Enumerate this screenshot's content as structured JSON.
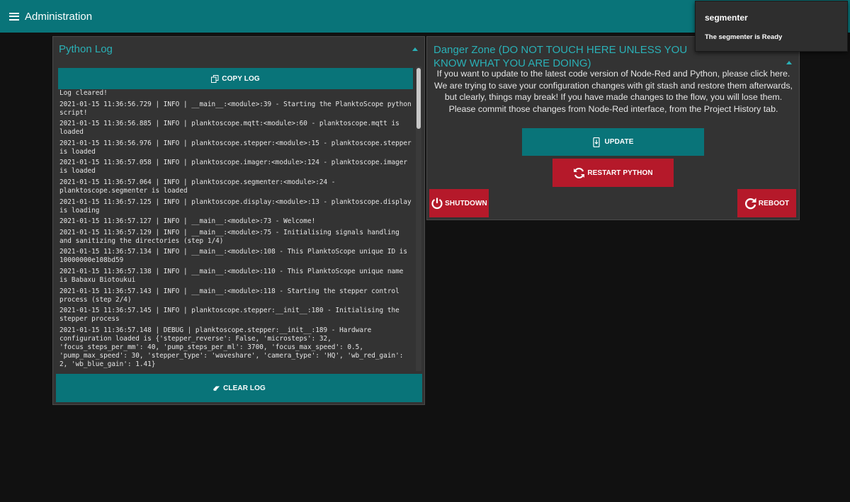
{
  "header": {
    "title": "Administration",
    "menu_icon": "hamburger-menu-icon",
    "color": "#097479"
  },
  "log_panel": {
    "title": "Python Log",
    "copy_button_label": "COPY LOG",
    "copy_icon": "copy-icon",
    "clear_button_label": "CLEAR LOG",
    "clear_icon": "eraser-icon",
    "lines": [
      "Log cleared!",
      "2021-01-15 11:36:56.729 | INFO | __main__:<module>:39 - Starting the PlanktoScope python script!",
      "2021-01-15 11:36:56.885 | INFO | planktoscope.mqtt:<module>:60 - planktoscope.mqtt is loaded",
      "2021-01-15 11:36:56.976 | INFO | planktoscope.stepper:<module>:15 - planktoscope.stepper is loaded",
      "2021-01-15 11:36:57.058 | INFO | planktoscope.imager:<module>:124 - planktoscope.imager is loaded",
      "2021-01-15 11:36:57.064 | INFO | planktoscope.segmenter:<module>:24 - planktoscope.segmenter is loaded",
      "2021-01-15 11:36:57.125 | INFO | planktoscope.display:<module>:13 - planktoscope.display is loading",
      "2021-01-15 11:36:57.127 | INFO | __main__:<module>:73 - Welcome!",
      "2021-01-15 11:36:57.129 | INFO | __main__:<module>:75 - Initialising signals handling and sanitizing the directories (step 1/4)",
      "2021-01-15 11:36:57.134 | INFO | __main__:<module>:108 - This PlanktoScope unique ID is 10000000e108bd59",
      "2021-01-15 11:36:57.138 | INFO | __main__:<module>:110 - This PlanktoScope unique name is Babaxu Biotoukui",
      "2021-01-15 11:36:57.143 | INFO | __main__:<module>:118 - Starting the stepper control process (step 2/4)",
      "2021-01-15 11:36:57.145 | INFO | planktoscope.stepper:__init__:180 - Initialising the stepper process",
      "2021-01-15 11:36:57.148 | DEBUG | planktoscope.stepper:__init__:189 - Hardware configuration loaded is {'stepper_reverse': False, 'microsteps': 32, 'focus_steps_per_mm': 40, 'pump_steps_per_ml': 3700, 'focus_max_speed': 0.5, 'pump_max_speed': 30, 'stepper_type': 'waveshare', 'camera_type': 'HQ', 'wb_red_gain': 2, 'wb_blue_gain': 1.41}"
    ]
  },
  "danger_panel": {
    "title": "Danger Zone (DO NOT TOUCH HERE UNLESS YOU KNOW WHAT YOU ARE DOING)",
    "description": "If you want to update to the latest code version of Node-Red and Python, please click here. We are trying to save your configuration changes with git stash and restore them afterwards, but clearly, things may break! If you have made changes to the flow, you will lose them. Please commit those changes from Node-Red interface, from the Project History tab.",
    "update_label": "UPDATE",
    "update_icon": "phone-update-icon",
    "restart_label": "RESTART PYTHON",
    "restart_icon": "refresh-icon",
    "shutdown_label": "SHUTDOWN",
    "shutdown_icon": "power-icon",
    "reboot_label": "REBOOT",
    "reboot_icon": "redo-icon"
  },
  "toast": {
    "title": "segmenter",
    "message": "The segmenter is Ready"
  },
  "colors": {
    "accent": "#097479",
    "danger": "#b5192a",
    "title_text": "#2ab0b6",
    "panel_bg": "#333333",
    "page_bg": "#111111"
  }
}
